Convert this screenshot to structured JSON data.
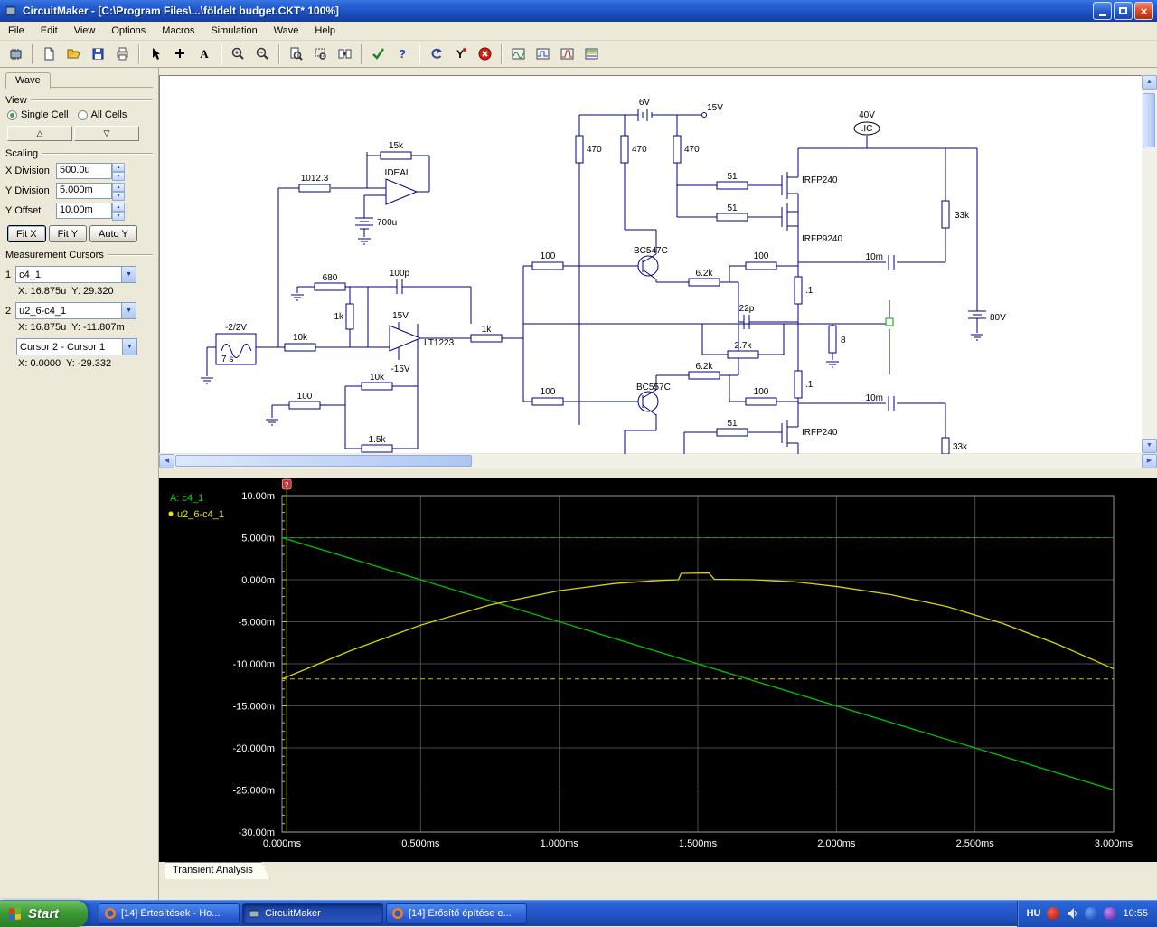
{
  "window": {
    "title": "CircuitMaker - [C:\\Program Files\\...\\földelt budget.CKT* 100%]"
  },
  "menubar": {
    "items": [
      "File",
      "Edit",
      "View",
      "Options",
      "Macros",
      "Simulation",
      "Wave",
      "Help"
    ]
  },
  "toolbar": {
    "icons": [
      "chip-icon",
      "new-document-icon",
      "open-folder-icon",
      "save-icon",
      "print-icon",
      "arrow-cursor-icon",
      "plus-icon",
      "text-tool-icon",
      "zoom-in-icon",
      "zoom-out-icon",
      "page-zoom-icon",
      "zoom-area-icon",
      "split-view-icon",
      "probe-check-icon",
      "help-icon",
      "undo-icon",
      "probe-y-icon",
      "stop-icon",
      "scope-icon",
      "meter-icon",
      "logic-display-icon",
      "bode-display-icon"
    ]
  },
  "wave_panel": {
    "tab": "Wave",
    "view": {
      "label": "View",
      "single_cell": "Single Cell",
      "all_cells": "All Cells",
      "up_glyph": "△",
      "down_glyph": "▽"
    },
    "scaling": {
      "label": "Scaling",
      "x_division_label": "X Division",
      "x_division": "500.0u",
      "y_division_label": "Y Division",
      "y_division": "5.000m",
      "y_offset_label": "Y Offset",
      "y_offset": "10.00m",
      "fit_x": "Fit X",
      "fit_y": "Fit Y",
      "auto_y": "Auto Y"
    },
    "cursors": {
      "label": "Measurement Cursors",
      "c1_index": "1",
      "c1_signal": "c4_1",
      "c1_readout": "X: 16.875u  Y: 29.320",
      "c2_index": "2",
      "c2_signal": "u2_6-c4_1",
      "c2_readout": "X: 16.875u  Y: -11.807m",
      "diff_label": "Cursor 2 - Cursor 1",
      "diff_readout": "X: 0.0000  Y: -29.332"
    }
  },
  "schematic": {
    "labels": [
      "15k",
      "IDEAL",
      "1012.3",
      "700u",
      "6V",
      "15V",
      "470",
      "470",
      "470",
      "51",
      "IRFP240",
      "51",
      "IRFP9240",
      "40V",
      ".IC",
      "33k",
      "10m",
      "100",
      "BC547C",
      "6.2k",
      "100",
      ".1",
      "80V",
      "680",
      "100p",
      "1k",
      "15V",
      "LT1223",
      "-15V",
      "1k",
      "22p",
      "2.7k",
      "8",
      "-2/2V",
      "7 s",
      "10k",
      "10k",
      "100",
      "1.5k",
      "100",
      "BC557C",
      "6.2k",
      "100",
      ".1",
      "10m",
      "51",
      "IRFP240",
      "33k"
    ]
  },
  "chart_data": {
    "type": "line",
    "title": "Transient Analysis",
    "bg": "#000000",
    "grid_color": "#4a4a4a",
    "frame_color": "#9a9a9a",
    "xlim": [
      0,
      3
    ],
    "ylim": [
      -30,
      10
    ],
    "x_unit": "ms",
    "y_unit": "m",
    "grid": true,
    "legend_position": "top-left",
    "x_ticks": [
      {
        "v": 0,
        "label": "0.000ms"
      },
      {
        "v": 0.5,
        "label": "0.500ms"
      },
      {
        "v": 1,
        "label": "1.000ms"
      },
      {
        "v": 1.5,
        "label": "1.500ms"
      },
      {
        "v": 2,
        "label": "2.000ms"
      },
      {
        "v": 2.5,
        "label": "2.500ms"
      },
      {
        "v": 3,
        "label": "3.000ms"
      }
    ],
    "y_ticks": [
      {
        "v": 10,
        "label": "10.00m"
      },
      {
        "v": 5,
        "label": "5.000m"
      },
      {
        "v": 0,
        "label": "0.000m"
      },
      {
        "v": -5,
        "label": "-5.000m"
      },
      {
        "v": -10,
        "label": "-10.000m"
      },
      {
        "v": -15,
        "label": "-15.000m"
      },
      {
        "v": -20,
        "label": "-20.000m"
      },
      {
        "v": -25,
        "label": "-25.000m"
      },
      {
        "v": -30,
        "label": "-30.00m"
      }
    ],
    "legend": [
      {
        "label": "A: c4_1",
        "color": "#00dd00",
        "bullet": false
      },
      {
        "label": "u2_6-c4_1",
        "color": "#e8e400",
        "bullet": true
      }
    ],
    "series": [
      {
        "name": "c4_1",
        "color": "#00c400",
        "points": [
          [
            0,
            5
          ],
          [
            3,
            -25
          ]
        ]
      },
      {
        "name": "u2_6-c4_1",
        "color": "#d8d400",
        "points": [
          [
            0,
            -11.8
          ],
          [
            0.25,
            -8.4
          ],
          [
            0.5,
            -5.4
          ],
          [
            0.75,
            -3.0
          ],
          [
            1,
            -1.3
          ],
          [
            1.2,
            -0.45
          ],
          [
            1.35,
            -0.1
          ],
          [
            1.43,
            0.0
          ],
          [
            1.44,
            0.75
          ],
          [
            1.54,
            0.8
          ],
          [
            1.56,
            0.05
          ],
          [
            1.7,
            0.0
          ],
          [
            1.85,
            -0.25
          ],
          [
            2,
            -0.8
          ],
          [
            2.2,
            -1.8
          ],
          [
            2.4,
            -3.2
          ],
          [
            2.6,
            -5.2
          ],
          [
            2.8,
            -7.7
          ],
          [
            3,
            -10.6
          ]
        ]
      }
    ],
    "cursors": {
      "vertical_x": 0.016875,
      "h_line_green": 5.0,
      "h_line_yellow": -11.807,
      "marker_label": "2"
    }
  },
  "bottom_tab": "Transient Analysis",
  "taskbar": {
    "start_label": "Start",
    "tasks": [
      "[14] Értesítések - Ho...",
      "CircuitMaker",
      "[14] Erősítő építése e..."
    ],
    "tray": {
      "language": "HU",
      "time": "10:55"
    }
  }
}
